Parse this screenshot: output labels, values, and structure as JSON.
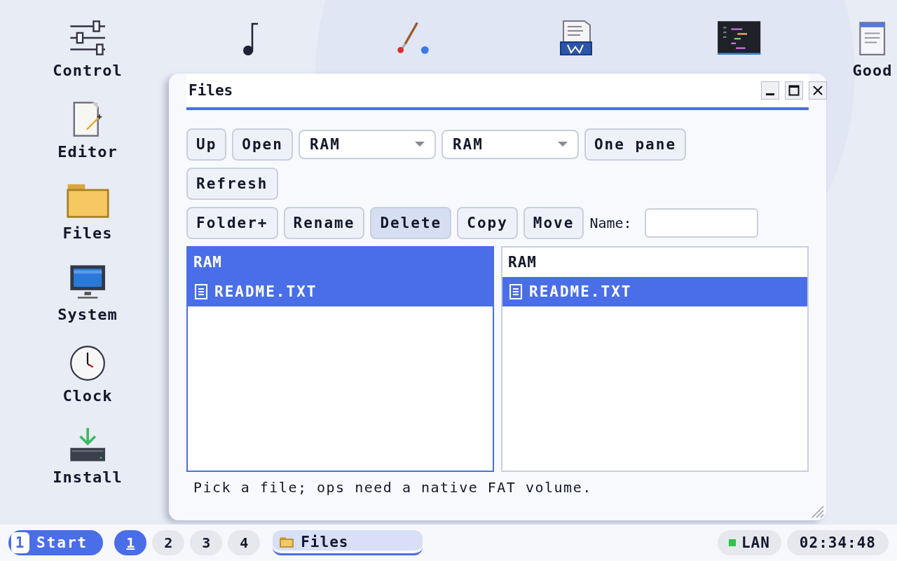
{
  "desktop_icons": [
    {
      "kind": "sliders",
      "label": "Control"
    },
    {
      "kind": "editor",
      "label": "Editor"
    },
    {
      "kind": "folder",
      "label": "Files"
    },
    {
      "kind": "monitor",
      "label": "System"
    },
    {
      "kind": "clock",
      "label": "Clock"
    },
    {
      "kind": "install",
      "label": "Install"
    },
    {
      "kind": "note"
    },
    {
      "kind": "brush"
    },
    {
      "kind": "word"
    },
    {
      "kind": "code"
    },
    {
      "kind": "doc",
      "label": "Good"
    }
  ],
  "window": {
    "title": "Files",
    "toolbar_rows": [
      [
        {
          "kind": "button",
          "label": "Up"
        },
        {
          "kind": "button",
          "label": "Open"
        },
        {
          "kind": "select",
          "value": "RAM"
        },
        {
          "kind": "select",
          "value": "RAM"
        },
        {
          "kind": "button",
          "label": "One pane"
        }
      ],
      [
        {
          "kind": "button",
          "label": "Refresh"
        }
      ],
      [
        {
          "kind": "button",
          "label": "Folder+"
        },
        {
          "kind": "button",
          "label": "Rename"
        },
        {
          "kind": "button",
          "label": "Delete",
          "pressed": true
        },
        {
          "kind": "button",
          "label": "Copy"
        },
        {
          "kind": "button",
          "label": "Move"
        },
        {
          "kind": "label",
          "label": "Name:"
        },
        {
          "kind": "input"
        }
      ]
    ],
    "panes": [
      {
        "header": "RAM",
        "active": true,
        "items": [
          {
            "name": "README.TXT",
            "selected": true
          }
        ]
      },
      {
        "header": "RAM",
        "active": false,
        "items": [
          {
            "name": "README.TXT",
            "selected": true
          }
        ]
      }
    ],
    "status": "Pick a file; ops need a native FAT volume."
  },
  "taskbar": {
    "start": {
      "badge": "1",
      "label": "Start"
    },
    "workspaces": [
      {
        "label": "1",
        "selected": true
      },
      {
        "label": "2",
        "selected": false
      },
      {
        "label": "3",
        "selected": false
      },
      {
        "label": "4",
        "selected": false
      }
    ],
    "tasks": [
      {
        "label": "Files",
        "selected": true
      }
    ],
    "network": {
      "label": "LAN",
      "connected": true
    },
    "clock": "02:34:48"
  }
}
